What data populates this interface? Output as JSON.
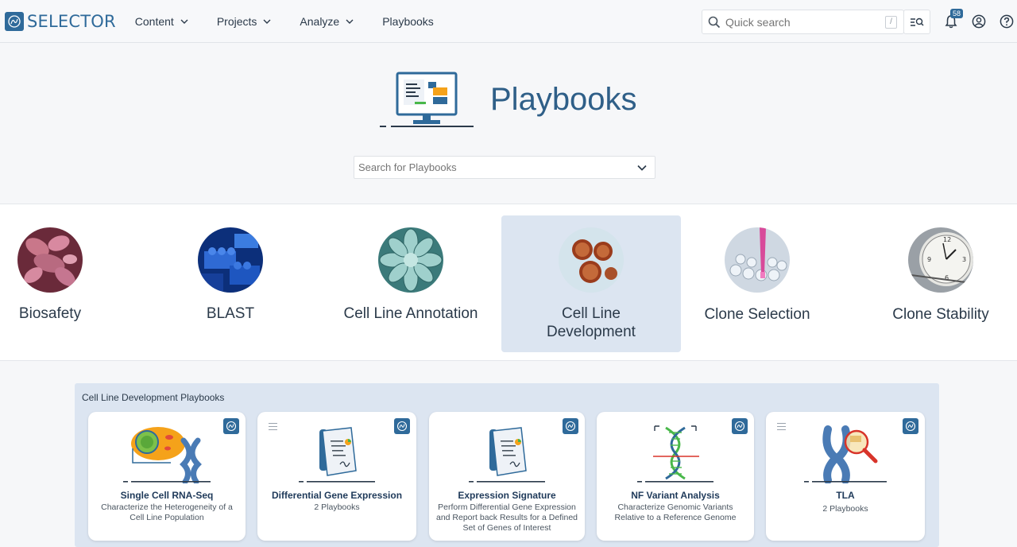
{
  "header": {
    "logo_text": "SELECTOR",
    "nav": [
      {
        "label": "Content",
        "has_menu": true
      },
      {
        "label": "Projects",
        "has_menu": true
      },
      {
        "label": "Analyze",
        "has_menu": true
      },
      {
        "label": "Playbooks",
        "has_menu": false
      }
    ],
    "search_placeholder": "Quick search",
    "search_shortcut": "/",
    "notification_count": "58",
    "icons": [
      "advanced-search-icon",
      "bell-icon",
      "user-icon",
      "help-icon"
    ]
  },
  "hero": {
    "title": "Playbooks",
    "search_placeholder": "Search for Playbooks"
  },
  "categories": [
    {
      "label": "Biosafety",
      "active": false
    },
    {
      "label": "BLAST",
      "active": false
    },
    {
      "label": "Cell Line Annotation",
      "active": false
    },
    {
      "label": "Cell Line Development",
      "active": true
    },
    {
      "label": "Clone Selection",
      "active": false
    },
    {
      "label": "Clone Stability",
      "active": false
    }
  ],
  "panel": {
    "title": "Cell Line Development Playbooks",
    "cards": [
      {
        "title": "Single Cell RNA-Seq",
        "subtitle": "Characterize the Heterogeneity of a Cell Line Population",
        "has_menu": false
      },
      {
        "title": "Differential Gene Expression",
        "subtitle": "2 Playbooks",
        "has_menu": true
      },
      {
        "title": "Expression Signature",
        "subtitle": "Perform Differential Gene Expression and Report back Results for a Defined Set of Genes of Interest",
        "has_menu": false
      },
      {
        "title": "NF Variant Analysis",
        "subtitle": "Characterize Genomic Variants Relative to a Reference Genome",
        "has_menu": false
      },
      {
        "title": "TLA",
        "subtitle": "2 Playbooks",
        "has_menu": true
      }
    ]
  },
  "colors": {
    "brand": "#2f6a9a",
    "active_tile": "#dce5f1",
    "panel": "#dce5f1"
  }
}
